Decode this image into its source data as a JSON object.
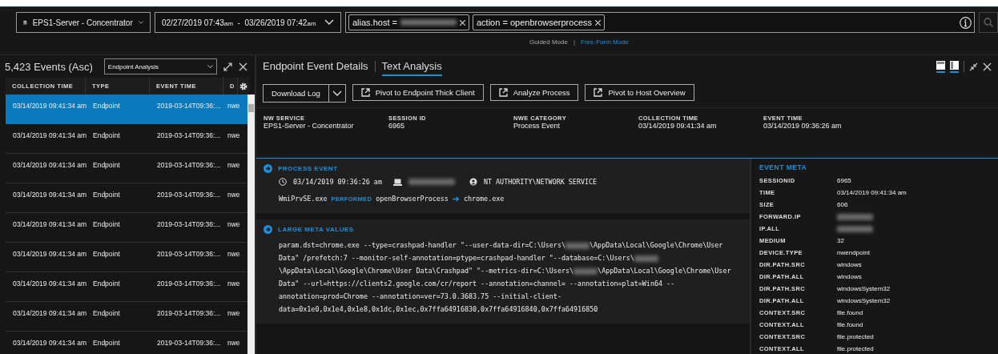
{
  "query_bar": {
    "service": "EPS1-Server - Concentrator",
    "time_range": {
      "start": "02/27/2019 07:43",
      "start_suffix": "am",
      "separator": "-",
      "end": "03/26/2019 07:42",
      "end_suffix": "am"
    },
    "pills": [
      {
        "field": "alias.host",
        "operator": "=",
        "value_redacted": true
      },
      {
        "field": "action",
        "operator": "=",
        "value_redacted": false,
        "value": "openbrowserprocess"
      }
    ],
    "mode_separator": "|",
    "modes": [
      {
        "label": "Guided Mode",
        "selected": false
      },
      {
        "label": "Free-Form Mode",
        "selected": true
      }
    ]
  },
  "events_panel": {
    "count": "5,423 Events (Asc)",
    "view": "Endpoint Analysis",
    "columns": [
      "COLLECTION TIME",
      "TYPE",
      "EVENT TIME",
      "D"
    ],
    "rows": [
      {
        "cells": [
          "03/14/2019 09:41:34 am",
          "Endpoint",
          "2019-03-14T09:36:...",
          "nwe"
        ],
        "selected": true
      },
      {
        "cells": [
          "03/14/2019 09:41:34 am",
          "Endpoint",
          "2019-03-14T09:36:...",
          "nwe"
        ],
        "selected": false
      },
      {
        "cells": [
          "03/14/2019 09:41:34 am",
          "Endpoint",
          "2019-03-14T09:36:...",
          "nwe"
        ],
        "selected": false
      },
      {
        "cells": [
          "03/14/2019 09:41:34 am",
          "Endpoint",
          "2019-03-14T09:36:...",
          "nwe"
        ],
        "selected": false
      },
      {
        "cells": [
          "03/14/2019 09:41:34 am",
          "Endpoint",
          "2019-03-14T09:36:...",
          "nwe"
        ],
        "selected": false
      },
      {
        "cells": [
          "03/14/2019 09:41:34 am",
          "Endpoint",
          "2019-03-14T09:36:...",
          "nwe"
        ],
        "selected": false
      },
      {
        "cells": [
          "03/14/2019 09:41:34 am",
          "Endpoint",
          "2019-03-14T09:36:...",
          "nwe"
        ],
        "selected": false
      },
      {
        "cells": [
          "03/14/2019 09:41:34 am",
          "Endpoint",
          "2019-03-14T09:36:...",
          "nwe"
        ],
        "selected": false
      },
      {
        "cells": [
          "03/14/2019 09:41:34 am",
          "Endpoint",
          "2019-03-14T09:36:...",
          "nwe"
        ],
        "selected": false
      }
    ]
  },
  "detail_panel": {
    "tabs": [
      {
        "label": "Endpoint Event Details",
        "selected": false
      },
      {
        "label": "Text Analysis",
        "selected": true
      }
    ],
    "layout_toggles": [
      {
        "kind": "top",
        "selected": true
      },
      {
        "kind": "side",
        "selected": true
      }
    ],
    "download_button": "Download Log",
    "actions": [
      "Pivot to Endpoint Thick Client",
      "Analyze Process",
      "Pivot to Host Overview"
    ],
    "summary": [
      {
        "label": "NW SERVICE",
        "value": "EPS1-Server - Concentrator"
      },
      {
        "label": "SESSION ID",
        "value": "6965"
      },
      {
        "label": "NWE CATEGORY",
        "value": "Process Event"
      },
      {
        "label": "COLLECTION TIME",
        "value": "03/14/2019 09:41:34 am"
      },
      {
        "label": "EVENT TIME",
        "value": "03/14/2019 09:36:26 am"
      }
    ],
    "process_event": {
      "title": "PROCESS EVENT",
      "time": "03/14/2019 09:36:26 am",
      "user": "NT AUTHORITY\\NETWORK SERVICE",
      "source": "WmiPrvSE.exe",
      "verb": "PERFORMED",
      "action": "openBrowserProcess",
      "target": "chrome.exe"
    },
    "large_meta": {
      "title": "LARGE META VALUES",
      "parts": [
        "param.dst=chrome.exe --type=crashpad-handler \"--user-data-dir=C:\\Users\\",
        "\\AppData\\Local\\Google\\Chrome\\User Data\" /prefetch:7 --monitor-self-annotation=ptype=crashpad-handler \"--database=C:\\Users\\",
        "\\AppData\\Local\\Google\\Chrome\\User Data\\Crashpad\" \"--metrics-dir=C:\\Users\\",
        "\\AppData\\Local\\Google\\Chrome\\User Data\" --url=https://clients2.google.com/cr/report --annotation=channel= --annotation=plat=Win64 --annotation=prod=Chrome --annotation=ver=73.0.3683.75 --initial-client-data=0x1e0,0x1e4,0x1e8,0x1dc,0x1ec,0x7ffa64916830,0x7ffa64916840,0x7ffa64916850"
      ]
    },
    "event_meta": {
      "title": "EVENT META",
      "rows": [
        {
          "key": "SESSIONID",
          "value": "6965",
          "redacted": false
        },
        {
          "key": "TIME",
          "value": "03/14/2019 09:41:34 am",
          "redacted": false
        },
        {
          "key": "SIZE",
          "value": "606",
          "redacted": false
        },
        {
          "key": "FORWARD.IP",
          "redacted": true
        },
        {
          "key": "IP.ALL",
          "redacted": true
        },
        {
          "key": "MEDIUM",
          "value": "32",
          "redacted": false
        },
        {
          "key": "DEVICE.TYPE",
          "value": "nwendpoint",
          "redacted": false
        },
        {
          "key": "DIR.PATH.SRC",
          "value": "windows",
          "redacted": false
        },
        {
          "key": "DIR.PATH.ALL",
          "value": "windows",
          "redacted": false
        },
        {
          "key": "DIR.PATH.SRC",
          "value": "windowsSystem32",
          "redacted": false
        },
        {
          "key": "DIR.PATH.ALL",
          "value": "windowsSystem32",
          "redacted": false
        },
        {
          "key": "CONTEXT.SRC",
          "value": "file.found",
          "redacted": false
        },
        {
          "key": "CONTEXT.ALL",
          "value": "file.found",
          "redacted": false
        },
        {
          "key": "CONTEXT.SRC",
          "value": "file.protected",
          "redacted": false
        },
        {
          "key": "CONTEXT.ALL",
          "value": "file.protected",
          "redacted": false
        }
      ]
    }
  }
}
